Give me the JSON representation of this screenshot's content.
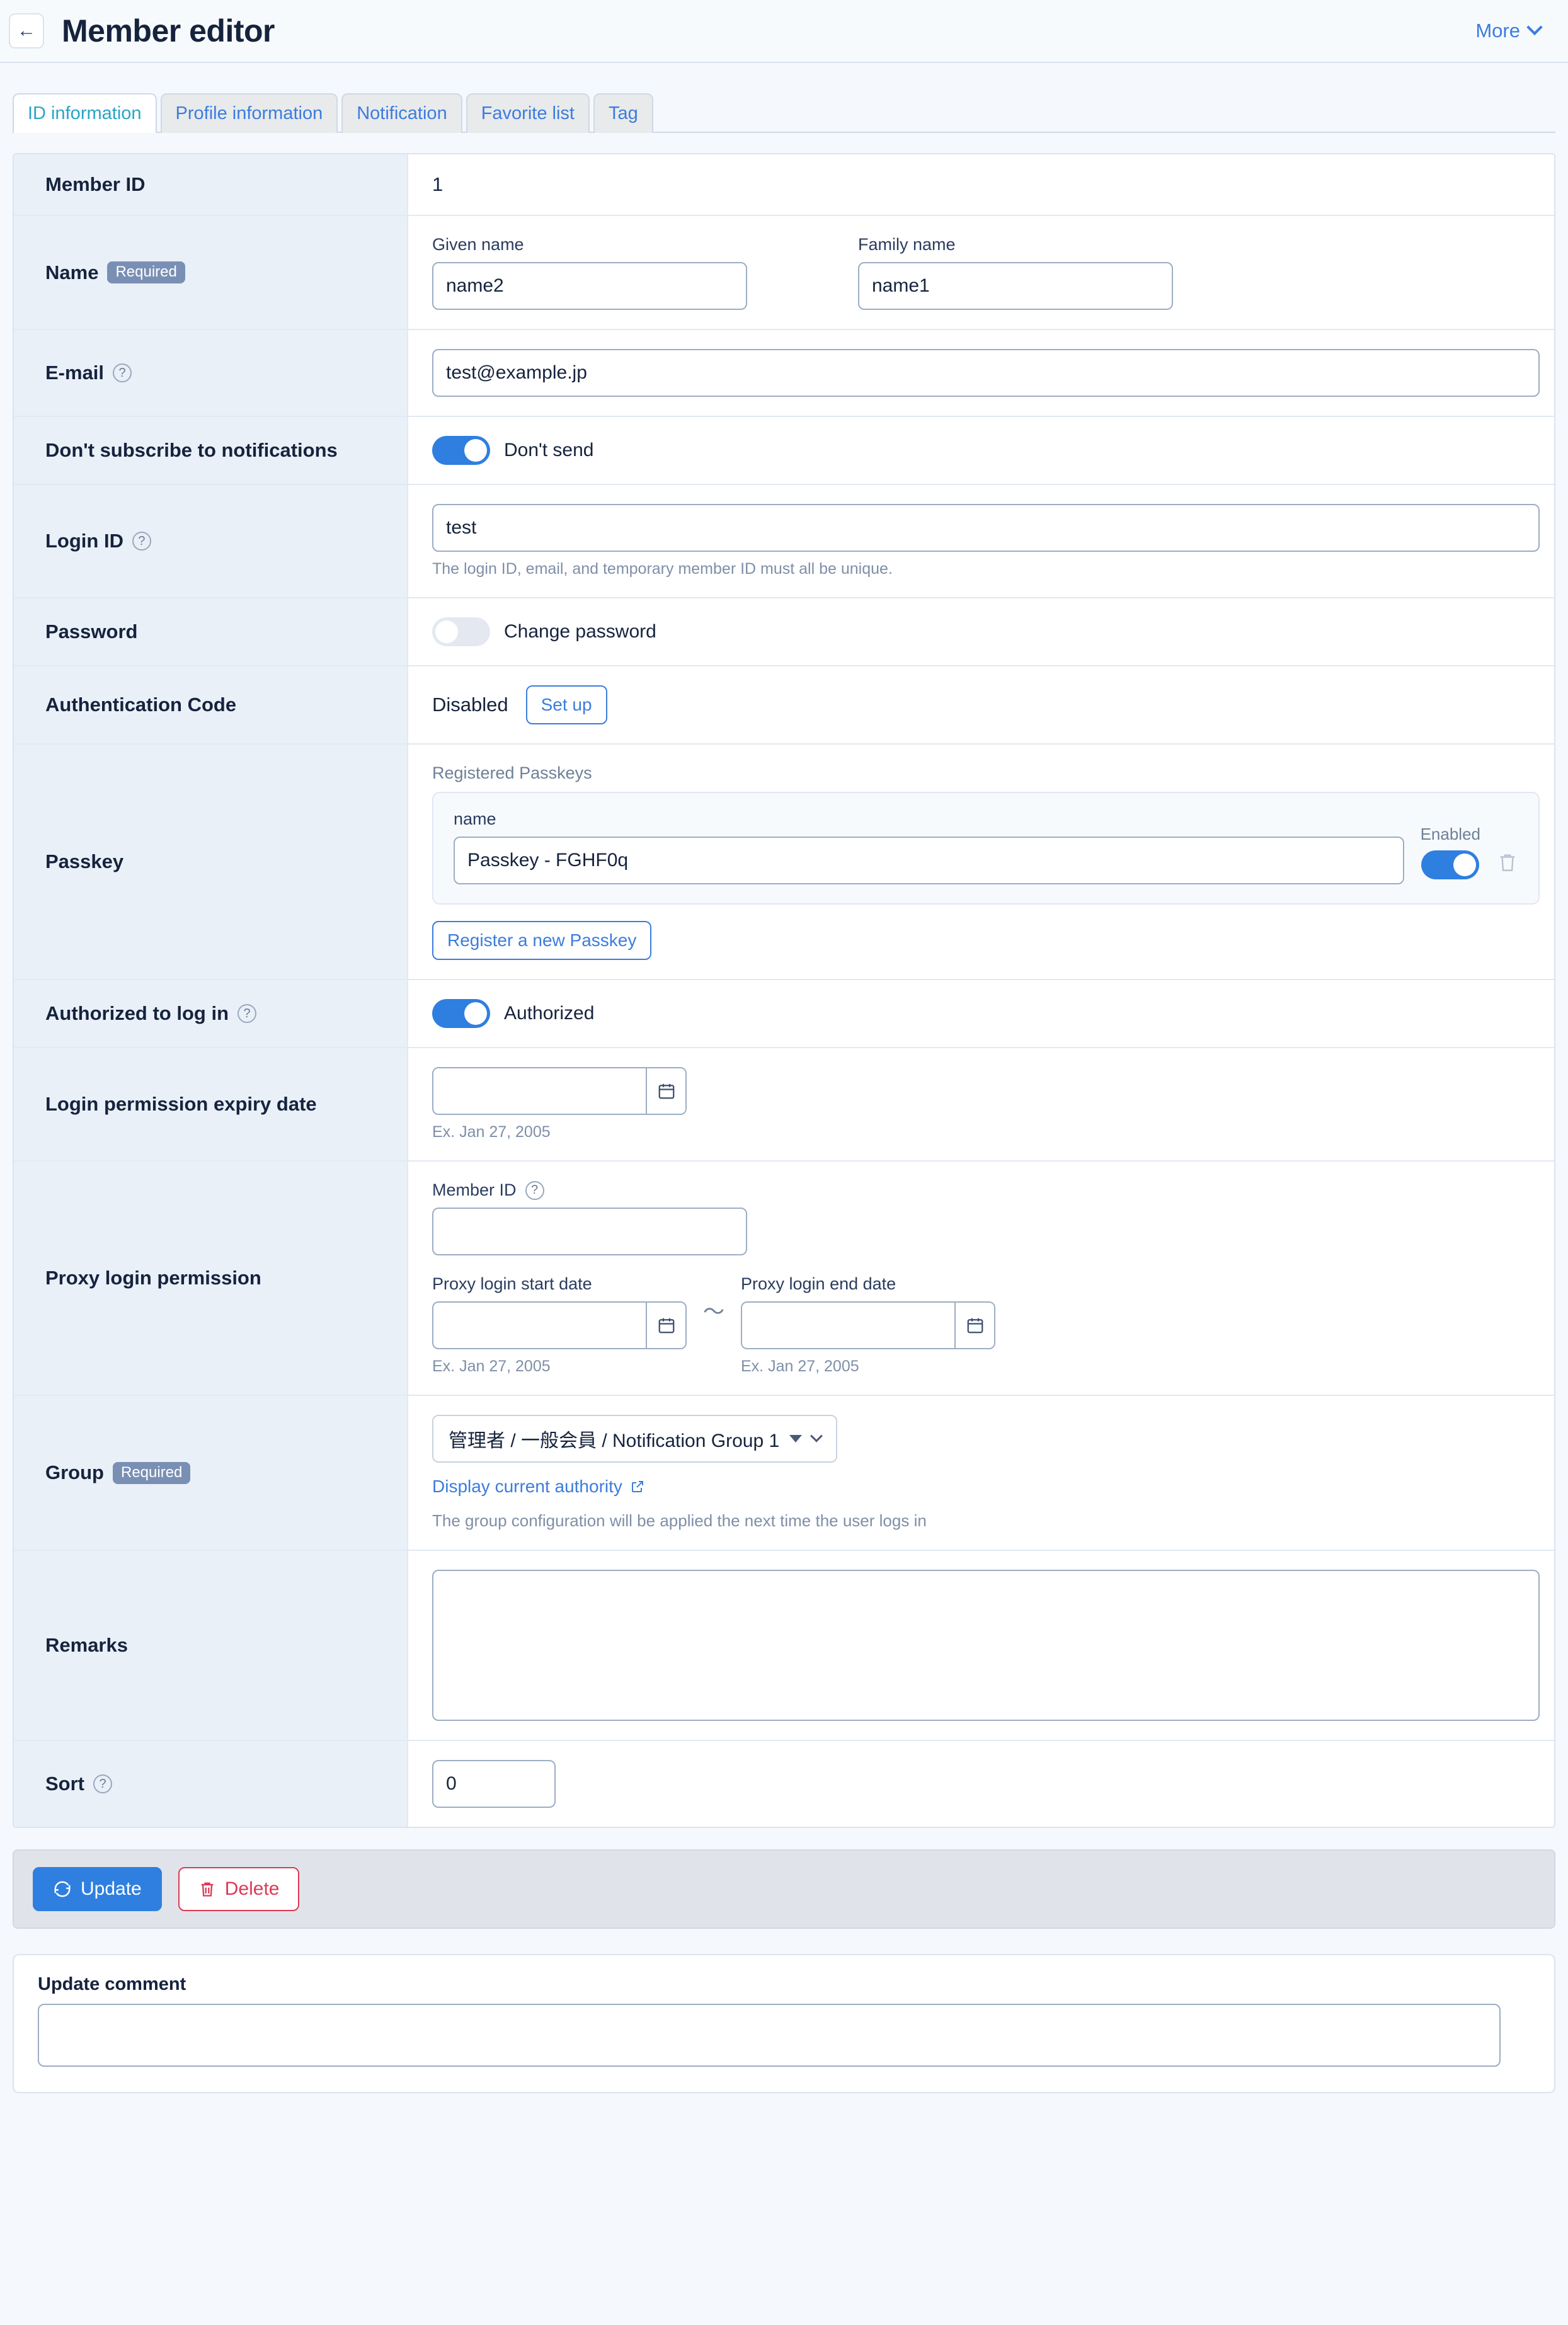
{
  "header": {
    "back_label": "←",
    "title": "Member editor",
    "more_label": "More"
  },
  "tabs": [
    {
      "label": "ID information",
      "active": true
    },
    {
      "label": "Profile information",
      "active": false
    },
    {
      "label": "Notification",
      "active": false
    },
    {
      "label": "Favorite list",
      "active": false
    },
    {
      "label": "Tag",
      "active": false
    }
  ],
  "rows": {
    "member_id": {
      "label": "Member ID",
      "value": "1"
    },
    "name": {
      "label": "Name",
      "required_badge": "Required",
      "given_label": "Given name",
      "given_value": "name2",
      "family_label": "Family name",
      "family_value": "name1"
    },
    "email": {
      "label": "E-mail",
      "help": "?",
      "value": "test@example.jp"
    },
    "no_subscribe": {
      "label": "Don't subscribe to notifications",
      "toggle_state": "on",
      "toggle_text": "Don't send"
    },
    "login_id": {
      "label": "Login ID",
      "help": "?",
      "value": "test",
      "hint": "The login ID, email, and temporary member ID must all be unique."
    },
    "password": {
      "label": "Password",
      "toggle_state": "off",
      "toggle_text": "Change password"
    },
    "auth_code": {
      "label": "Authentication Code",
      "status": "Disabled",
      "setup_label": "Set up"
    },
    "passkey": {
      "label": "Passkey",
      "section_label": "Registered Passkeys",
      "name_label": "name",
      "name_value": "Passkey - FGHF0q",
      "enabled_label": "Enabled",
      "enabled_state": "on",
      "delete_icon": "trash-icon",
      "register_label": "Register a new Passkey"
    },
    "authorized": {
      "label": "Authorized to log in",
      "help": "?",
      "toggle_state": "on",
      "toggle_text": "Authorized"
    },
    "login_expiry": {
      "label": "Login permission expiry date",
      "value": "",
      "hint": "Ex. Jan 27, 2005"
    },
    "proxy": {
      "label": "Proxy login permission",
      "member_id_label": "Member ID",
      "member_id_help": "?",
      "member_id_value": "",
      "start_label": "Proxy login start date",
      "start_value": "",
      "start_hint": "Ex. Jan 27, 2005",
      "separator": "〜",
      "end_label": "Proxy login end date",
      "end_value": "",
      "end_hint": "Ex. Jan 27, 2005"
    },
    "group": {
      "label": "Group",
      "required_badge": "Required",
      "select_value": "管理者 / 一般会員 / Notification Group 1",
      "link_label": "Display current authority",
      "note": "The group configuration will be applied the next time the user logs in"
    },
    "remarks": {
      "label": "Remarks",
      "value": ""
    },
    "sort": {
      "label": "Sort",
      "help": "?",
      "value": "0"
    }
  },
  "actions": {
    "update_label": "Update",
    "delete_label": "Delete"
  },
  "comment": {
    "label": "Update comment",
    "value": ""
  },
  "colors": {
    "accent": "#3b7ddd",
    "toggle_on": "#2f7fe0",
    "danger": "#dc3a56",
    "active_tab_text": "#2aa5c4",
    "required_badge": "#7a8fb4"
  }
}
